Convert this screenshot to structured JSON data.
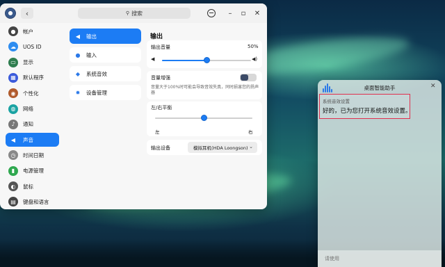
{
  "settings": {
    "search_placeholder": "搜索",
    "sidebar": {
      "items": [
        {
          "label": "帐户",
          "icon": "user-icon",
          "color": "#444444"
        },
        {
          "label": "UOS ID",
          "icon": "cloud-icon",
          "color": "#2d8cf0"
        },
        {
          "label": "显示",
          "icon": "monitor-icon",
          "color": "#2e7d4f"
        },
        {
          "label": "默认程序",
          "icon": "default-apps-icon",
          "color": "#3b5bdb"
        },
        {
          "label": "个性化",
          "icon": "palette-icon",
          "color": "#b05a2c"
        },
        {
          "label": "网络",
          "icon": "network-icon",
          "color": "#1aa3a3"
        },
        {
          "label": "通知",
          "icon": "bell-icon",
          "color": "#777777"
        },
        {
          "label": "声音",
          "icon": "speaker-icon",
          "color": "#ffffff"
        },
        {
          "label": "时间日期",
          "icon": "clock-icon",
          "color": "#888888"
        },
        {
          "label": "电源管理",
          "icon": "battery-icon",
          "color": "#2fa84f"
        },
        {
          "label": "鼠标",
          "icon": "mouse-icon",
          "color": "#555555"
        },
        {
          "label": "键盘和语言",
          "icon": "keyboard-icon",
          "color": "#444444"
        }
      ],
      "active_index": 7
    },
    "subnav": {
      "items": [
        {
          "label": "输出",
          "icon": "speaker-icon"
        },
        {
          "label": "输入",
          "icon": "microphone-icon"
        },
        {
          "label": "系统音效",
          "icon": "sound-effects-icon"
        },
        {
          "label": "设备管理",
          "icon": "device-gear-icon"
        }
      ],
      "active_index": 0
    },
    "output": {
      "title": "输出",
      "volume_label": "输出音量",
      "volume_value_text": "50%",
      "volume_fraction": 0.5,
      "boost_label": "音量增强",
      "boost_enabled": false,
      "boost_hint": "音量大于100%时可能会导致音效失真，同时损害您的扬声器",
      "balance_label": "左/右平衡",
      "balance_left": "左",
      "balance_right": "右",
      "balance_fraction": 0.5,
      "device_label": "输出设备",
      "device_value": "模拟耳机(HDA Loongson)"
    }
  },
  "assistant": {
    "title": "桌面智能助手",
    "subtitle": "系统音效设置",
    "message": "好的，已为您打开系统音效设置。",
    "input_placeholder": "请使用",
    "highlight_color": "#e0304e"
  }
}
